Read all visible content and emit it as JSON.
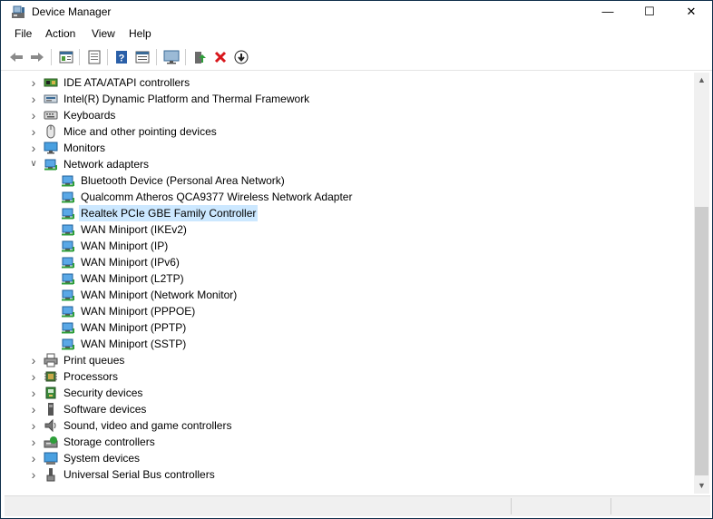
{
  "window": {
    "title": "Device Manager",
    "controls": {
      "minimize": "—",
      "maximize": "☐",
      "close": "✕"
    }
  },
  "menu": [
    "File",
    "Action",
    "View",
    "Help"
  ],
  "toolbar": {
    "buttons": [
      "back-icon",
      "forward-icon",
      "properties-icon",
      "driver-icon",
      "help-icon",
      "view-icon",
      "monitor-scan-icon",
      "update-driver-icon",
      "uninstall-icon",
      "disable-icon"
    ]
  },
  "tree": [
    {
      "label": "IDE ATA/ATAPI controllers",
      "icon": "ide-controller-icon",
      "level": 0,
      "expander": "collapsed"
    },
    {
      "label": "Intel(R) Dynamic Platform and Thermal Framework",
      "icon": "thermal-framework-icon",
      "level": 0,
      "expander": "collapsed"
    },
    {
      "label": "Keyboards",
      "icon": "keyboard-icon",
      "level": 0,
      "expander": "collapsed"
    },
    {
      "label": "Mice and other pointing devices",
      "icon": "mouse-icon",
      "level": 0,
      "expander": "collapsed"
    },
    {
      "label": "Monitors",
      "icon": "monitor-icon",
      "level": 0,
      "expander": "collapsed"
    },
    {
      "label": "Network adapters",
      "icon": "network-adapter-icon",
      "level": 0,
      "expander": "expanded"
    },
    {
      "label": "Bluetooth Device (Personal Area Network)",
      "icon": "network-adapter-icon",
      "level": 1
    },
    {
      "label": "Qualcomm Atheros QCA9377 Wireless Network Adapter",
      "icon": "network-adapter-icon",
      "level": 1
    },
    {
      "label": "Realtek PCIe GBE Family Controller",
      "icon": "network-adapter-icon",
      "level": 1,
      "selected": true
    },
    {
      "label": "WAN Miniport (IKEv2)",
      "icon": "network-adapter-icon",
      "level": 1
    },
    {
      "label": "WAN Miniport (IP)",
      "icon": "network-adapter-icon",
      "level": 1
    },
    {
      "label": "WAN Miniport (IPv6)",
      "icon": "network-adapter-icon",
      "level": 1
    },
    {
      "label": "WAN Miniport (L2TP)",
      "icon": "network-adapter-icon",
      "level": 1
    },
    {
      "label": "WAN Miniport (Network Monitor)",
      "icon": "network-adapter-icon",
      "level": 1
    },
    {
      "label": "WAN Miniport (PPPOE)",
      "icon": "network-adapter-icon",
      "level": 1
    },
    {
      "label": "WAN Miniport (PPTP)",
      "icon": "network-adapter-icon",
      "level": 1
    },
    {
      "label": "WAN Miniport (SSTP)",
      "icon": "network-adapter-icon",
      "level": 1
    },
    {
      "label": "Print queues",
      "icon": "printer-icon",
      "level": 0,
      "expander": "collapsed"
    },
    {
      "label": "Processors",
      "icon": "processor-icon",
      "level": 0,
      "expander": "collapsed"
    },
    {
      "label": "Security devices",
      "icon": "security-device-icon",
      "level": 0,
      "expander": "collapsed"
    },
    {
      "label": "Software devices",
      "icon": "software-device-icon",
      "level": 0,
      "expander": "collapsed"
    },
    {
      "label": "Sound, video and game controllers",
      "icon": "speaker-icon",
      "level": 0,
      "expander": "collapsed"
    },
    {
      "label": "Storage controllers",
      "icon": "storage-controller-icon",
      "level": 0,
      "expander": "collapsed"
    },
    {
      "label": "System devices",
      "icon": "system-device-icon",
      "level": 0,
      "expander": "collapsed"
    },
    {
      "label": "Universal Serial Bus controllers",
      "icon": "usb-icon",
      "level": 0,
      "expander": "collapsed"
    }
  ],
  "colors": {
    "selection": "#cce8ff",
    "accent": "#1a7fd3",
    "uninstall_red": "#d8161b"
  }
}
